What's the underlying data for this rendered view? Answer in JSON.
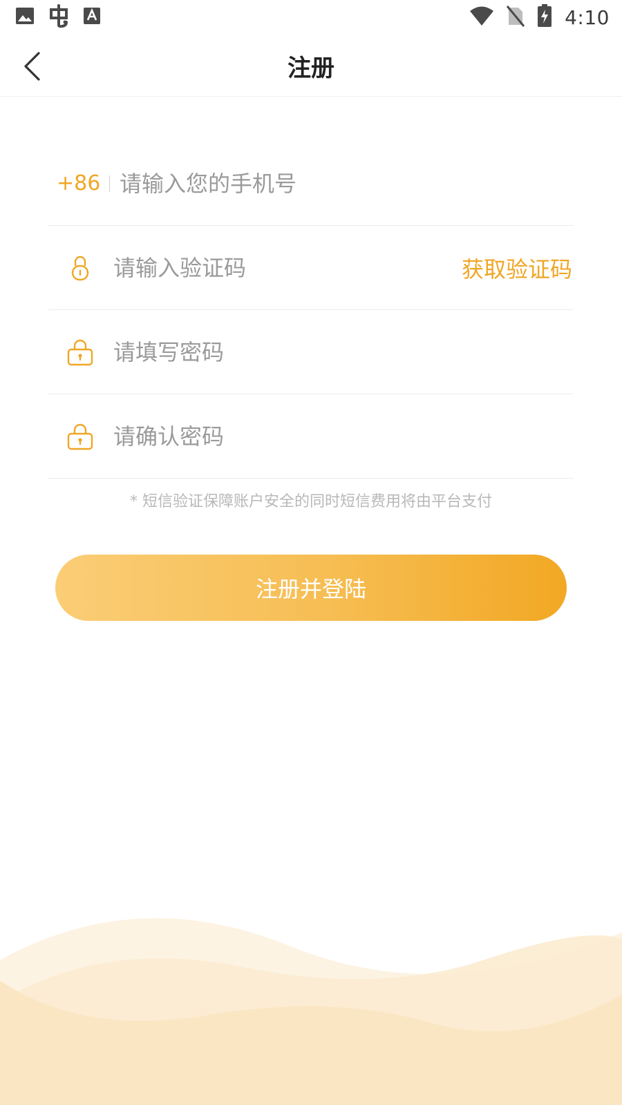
{
  "status_bar": {
    "time": "4:10",
    "left_icons": [
      "image-icon",
      "bug-icon",
      "font-a-icon"
    ],
    "right_icons": [
      "wifi-icon",
      "no-sim-icon",
      "battery-charging-icon"
    ]
  },
  "header": {
    "title": "注册"
  },
  "form": {
    "phone": {
      "country_code": "+86",
      "placeholder": "请输入您的手机号",
      "value": ""
    },
    "code": {
      "icon": "lock-icon",
      "placeholder": "请输入验证码",
      "value": "",
      "get_code_label": "获取验证码"
    },
    "password": {
      "icon": "padlock-icon",
      "placeholder": "请填写密码",
      "value": ""
    },
    "confirm_password": {
      "icon": "padlock-icon",
      "placeholder": "请确认密码",
      "value": ""
    },
    "notice": "* 短信验证保障账户安全的同时短信费用将由平台支付"
  },
  "submit": {
    "label": "注册并登陆"
  },
  "colors": {
    "accent": "#f0a625",
    "gradient_start": "#fbcd76",
    "gradient_end": "#f2a823",
    "wave": "#fbe6c4",
    "placeholder": "#9a9a9a"
  }
}
